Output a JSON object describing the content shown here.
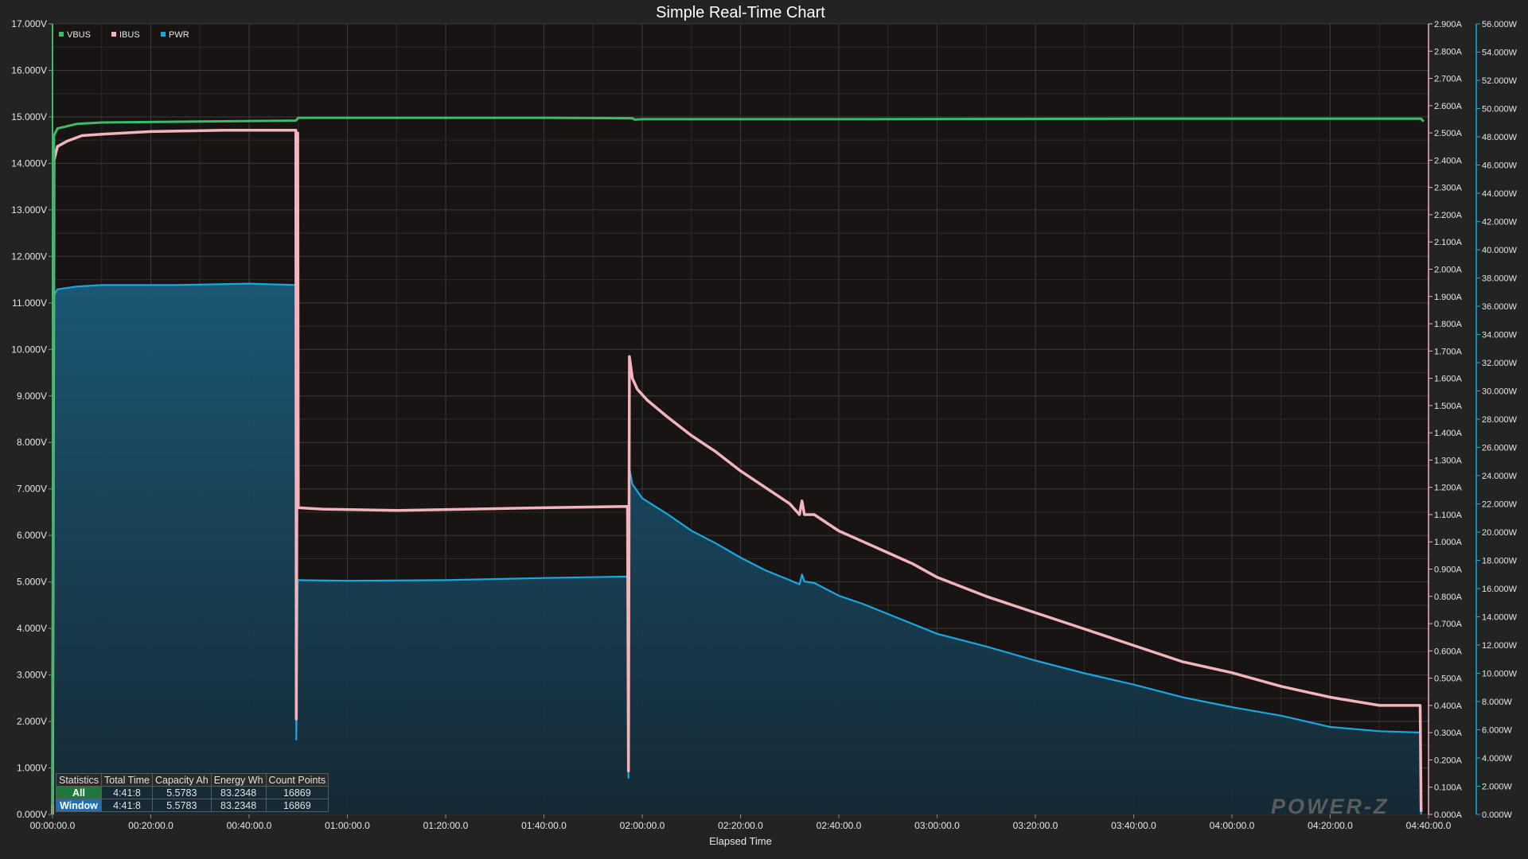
{
  "chart_data": {
    "type": "line",
    "title": "Simple Real-Time Chart",
    "xlabel": "Elapsed Time",
    "x_unit": "minutes",
    "xlim": [
      0,
      280
    ],
    "x_ticks": [
      "00:00:00.0",
      "00:20:00.0",
      "00:40:00.0",
      "01:00:00.0",
      "01:20:00.0",
      "01:40:00.0",
      "02:00:00.0",
      "02:20:00.0",
      "02:40:00.0",
      "03:00:00.0",
      "03:20:00.0",
      "03:40:00.0",
      "04:00:00.0",
      "04:20:00.0",
      "04:40:00.0"
    ],
    "y_left": {
      "label": "",
      "min": 0,
      "max": 17,
      "ticks": [
        "0.000V",
        "1.000V",
        "2.000V",
        "3.000V",
        "4.000V",
        "5.000V",
        "6.000V",
        "7.000V",
        "8.000V",
        "9.000V",
        "10.000V",
        "11.000V",
        "12.000V",
        "13.000V",
        "14.000V",
        "15.000V",
        "16.000V",
        "17.000V"
      ]
    },
    "y_right1": {
      "label": "",
      "min": 0,
      "max": 2.9,
      "ticks": [
        "0.000A",
        "0.100A",
        "0.200A",
        "0.300A",
        "0.400A",
        "0.500A",
        "0.600A",
        "0.700A",
        "0.800A",
        "0.900A",
        "1.000A",
        "1.100A",
        "1.200A",
        "1.300A",
        "1.400A",
        "1.500A",
        "1.600A",
        "1.700A",
        "1.800A",
        "1.900A",
        "2.000A",
        "2.100A",
        "2.200A",
        "2.300A",
        "2.400A",
        "2.500A",
        "2.600A",
        "2.700A",
        "2.800A",
        "2.900A"
      ]
    },
    "y_right2": {
      "label": "",
      "min": 0,
      "max": 56,
      "ticks": [
        "0.000W",
        "2.000W",
        "4.000W",
        "6.000W",
        "8.000W",
        "10.000W",
        "12.000W",
        "14.000W",
        "16.000W",
        "18.000W",
        "20.000W",
        "22.000W",
        "24.000W",
        "26.000W",
        "28.000W",
        "30.000W",
        "32.000W",
        "34.000W",
        "36.000W",
        "38.000W",
        "40.000W",
        "42.000W",
        "44.000W",
        "46.000W",
        "48.000W",
        "50.000W",
        "52.000W",
        "54.000W",
        "56.000W"
      ]
    },
    "legend_position": "top-left",
    "grid": true,
    "series": [
      {
        "name": "VBUS",
        "axis": "left",
        "color": "#3dba6a",
        "points": [
          [
            0,
            0.2
          ],
          [
            0.3,
            14.6
          ],
          [
            1,
            14.75
          ],
          [
            5,
            14.85
          ],
          [
            10,
            14.88
          ],
          [
            30,
            14.9
          ],
          [
            49.5,
            14.92
          ],
          [
            50,
            14.98
          ],
          [
            100,
            14.98
          ],
          [
            118,
            14.97
          ],
          [
            118.5,
            14.94
          ],
          [
            120,
            14.95
          ],
          [
            160,
            14.95
          ],
          [
            220,
            14.96
          ],
          [
            278.5,
            14.96
          ],
          [
            279,
            14.9
          ]
        ]
      },
      {
        "name": "IBUS",
        "axis": "right1",
        "color": "#f4b4bc",
        "points": [
          [
            0,
            0.0
          ],
          [
            0.3,
            2.4
          ],
          [
            1,
            2.45
          ],
          [
            3,
            2.47
          ],
          [
            6,
            2.49
          ],
          [
            10,
            2.495
          ],
          [
            20,
            2.505
          ],
          [
            35,
            2.51
          ],
          [
            49.5,
            2.51
          ],
          [
            49.6,
            0.35
          ],
          [
            49.9,
            2.5
          ],
          [
            50,
            1.125
          ],
          [
            55,
            1.12
          ],
          [
            70,
            1.115
          ],
          [
            85,
            1.12
          ],
          [
            100,
            1.125
          ],
          [
            117,
            1.13
          ],
          [
            117.2,
            0.16
          ],
          [
            117.4,
            1.68
          ],
          [
            118,
            1.6
          ],
          [
            119,
            1.56
          ],
          [
            121,
            1.52
          ],
          [
            125,
            1.46
          ],
          [
            130,
            1.39
          ],
          [
            135,
            1.33
          ],
          [
            140,
            1.26
          ],
          [
            145,
            1.2
          ],
          [
            150,
            1.14
          ],
          [
            152,
            1.1
          ],
          [
            152.5,
            1.15
          ],
          [
            153,
            1.1
          ],
          [
            155,
            1.1
          ],
          [
            160,
            1.04
          ],
          [
            165,
            1.0
          ],
          [
            170,
            0.96
          ],
          [
            175,
            0.92
          ],
          [
            180,
            0.87
          ],
          [
            190,
            0.8
          ],
          [
            200,
            0.74
          ],
          [
            210,
            0.68
          ],
          [
            220,
            0.62
          ],
          [
            230,
            0.56
          ],
          [
            240,
            0.52
          ],
          [
            250,
            0.47
          ],
          [
            260,
            0.43
          ],
          [
            270,
            0.4
          ],
          [
            278.3,
            0.4
          ],
          [
            278.5,
            0.01
          ]
        ]
      },
      {
        "name": "PWR",
        "axis": "right2",
        "color": "#1aa7e0",
        "fill": true,
        "points": [
          [
            0,
            0.0
          ],
          [
            0.3,
            36.8
          ],
          [
            1,
            37.2
          ],
          [
            5,
            37.4
          ],
          [
            10,
            37.5
          ],
          [
            25,
            37.5
          ],
          [
            40,
            37.6
          ],
          [
            49.5,
            37.5
          ],
          [
            49.6,
            5.3
          ],
          [
            49.9,
            16.5
          ],
          [
            50,
            16.6
          ],
          [
            60,
            16.55
          ],
          [
            80,
            16.6
          ],
          [
            100,
            16.75
          ],
          [
            117,
            16.85
          ],
          [
            117.2,
            2.6
          ],
          [
            117.4,
            24.5
          ],
          [
            118,
            23.4
          ],
          [
            120,
            22.4
          ],
          [
            125,
            21.3
          ],
          [
            130,
            20.1
          ],
          [
            135,
            19.2
          ],
          [
            140,
            18.2
          ],
          [
            145,
            17.3
          ],
          [
            150,
            16.6
          ],
          [
            152,
            16.3
          ],
          [
            152.5,
            17.0
          ],
          [
            153,
            16.5
          ],
          [
            155,
            16.4
          ],
          [
            160,
            15.5
          ],
          [
            165,
            14.9
          ],
          [
            170,
            14.2
          ],
          [
            180,
            12.8
          ],
          [
            190,
            11.9
          ],
          [
            200,
            10.9
          ],
          [
            210,
            10.0
          ],
          [
            220,
            9.2
          ],
          [
            230,
            8.3
          ],
          [
            240,
            7.6
          ],
          [
            250,
            7.0
          ],
          [
            260,
            6.2
          ],
          [
            270,
            5.9
          ],
          [
            278.3,
            5.8
          ],
          [
            278.5,
            0.0
          ]
        ]
      }
    ]
  },
  "stats_table": {
    "headers": [
      "Statistics",
      "Total Time",
      "Capacity Ah",
      "Energy Wh",
      "Count Points"
    ],
    "rows": [
      {
        "label": "All",
        "total_time": "4:41:8",
        "capacity": "5.5783",
        "energy": "83.2348",
        "count": "16869"
      },
      {
        "label": "Window",
        "total_time": "4:41:8",
        "capacity": "5.5783",
        "energy": "83.2348",
        "count": "16869"
      }
    ]
  },
  "logo": {
    "text": "POWER-Z"
  },
  "colors": {
    "plot_bg": "#181414",
    "page_bg": "#232323",
    "axis_left": "#3dba6a",
    "axis_right1": "#f4b4bc",
    "axis_right2": "#1aa7e0"
  }
}
